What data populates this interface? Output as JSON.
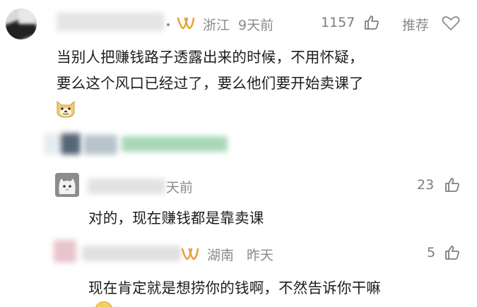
{
  "comments": [
    {
      "location": "浙江",
      "time": "9天前",
      "like_count": "1157",
      "recommend_label": "推荐",
      "text_line1": "当别人把赚钱路子透露出来的时候，不用怀疑，",
      "text_line2": "要么这个风口已经过了，要么他们要开始卖课了",
      "emoji": "doge-emoji"
    },
    {
      "time_partial": "天前",
      "like_count": "23",
      "text": "对的，现在赚钱都是靠卖课"
    },
    {
      "location": "湖南",
      "time": "昨天",
      "like_count": "5",
      "text": "现在肯定就是想捞你的钱啊，不然告诉你干嘛"
    }
  ],
  "icons": {
    "like": "thumbs-up-icon",
    "favorite": "heart-icon",
    "ip": "ip-location-icon"
  },
  "colors": {
    "meta_gray": "#8a8a8a",
    "ip_icon_orange": "#e6a23c",
    "blur_green": "#a8d8b8"
  }
}
